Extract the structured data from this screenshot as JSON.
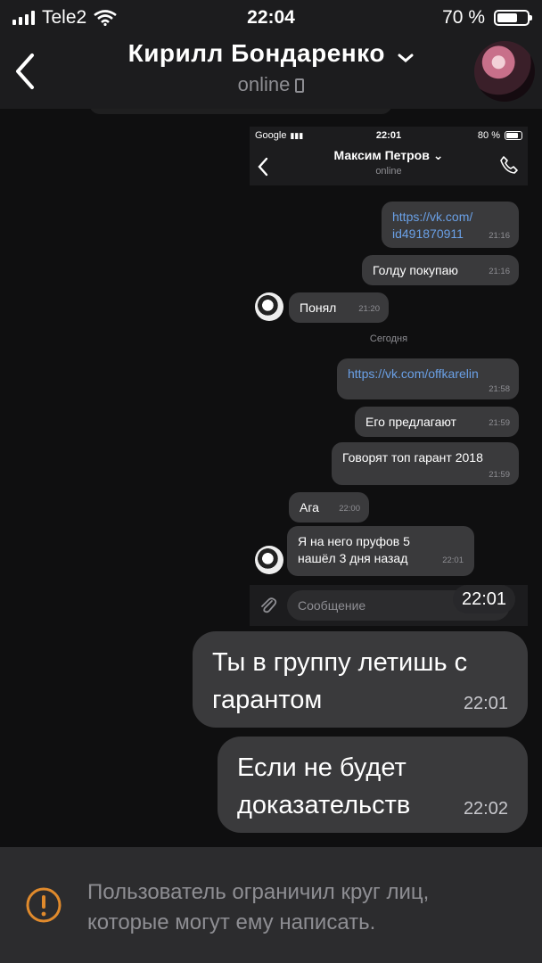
{
  "status_bar": {
    "carrier": "Tele2",
    "time": "22:04",
    "battery": "70 %",
    "battery_level": 0.7
  },
  "header": {
    "title": "Кирилл Бондаренко",
    "subtitle": "online"
  },
  "screenshot": {
    "status": {
      "carrier": "Google",
      "time": "22:01",
      "battery": "80 %"
    },
    "header": {
      "title": "Максим Петров",
      "subtitle": "online"
    },
    "messages": [
      {
        "text": "https://vk.com/\nid491870911",
        "time": "21:16"
      },
      {
        "text": "Голду покупаю",
        "time": "21:16"
      },
      {
        "text": "Понял",
        "time": "21:20"
      },
      {
        "text": "https://vk.com/offkarelin",
        "time": "21:58"
      },
      {
        "text": "Его предлагают",
        "time": "21:59"
      },
      {
        "text": "Говорят топ гарант 2018",
        "time": "21:59"
      },
      {
        "text": "Ага",
        "time": "22:00"
      },
      {
        "text": "Я на него пруфов 5\nнашёл 3 дня назад",
        "time": "22:01"
      }
    ],
    "day_divider": "Сегодня",
    "input_placeholder": "Сообщение"
  },
  "image_time": "22:01",
  "messages": [
    {
      "text": "Ты в группу летишь с\nгарантом",
      "time": "22:01"
    },
    {
      "text": "Если не будет\nдоказательств",
      "time": "22:02"
    }
  ],
  "notice": "Пользователь ограничил круг лиц, которые могут ему написать.",
  "colors": {
    "background": "#0f0f10",
    "bubble": "#3a3a3c",
    "link": "#6aa0e6",
    "warning": "#e08a2c"
  }
}
